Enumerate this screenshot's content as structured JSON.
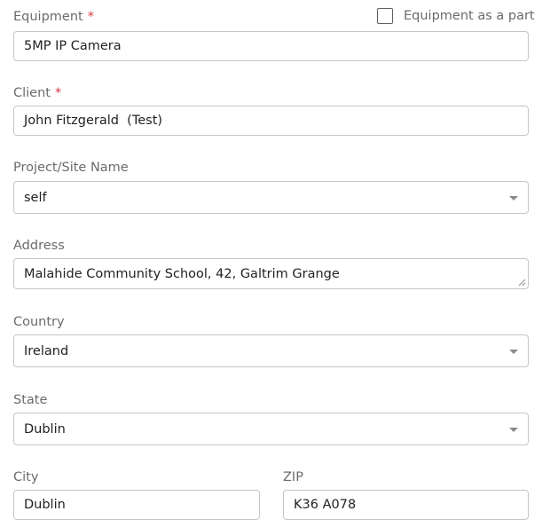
{
  "equipment": {
    "label": "Equipment",
    "required_mark": "*",
    "value": "5MP IP Camera",
    "as_part_label": "Equipment as a part",
    "as_part_checked": false
  },
  "client": {
    "label": "Client",
    "required_mark": "*",
    "value": "John Fitzgerald  (Test)"
  },
  "project": {
    "label": "Project/Site Name",
    "value": "self",
    "icon": "chevron-down-icon"
  },
  "address": {
    "label": "Address",
    "value": "Malahide Community School, 42, Galtrim Grange",
    "icon": "resize-handle-icon"
  },
  "country": {
    "label": "Country",
    "value": "Ireland",
    "icon": "chevron-down-icon"
  },
  "state": {
    "label": "State",
    "value": "Dublin",
    "icon": "chevron-down-icon"
  },
  "city": {
    "label": "City",
    "value": "Dublin"
  },
  "zip": {
    "label": "ZIP",
    "value": "K36 A078"
  },
  "colors": {
    "required": "#d9363e",
    "label": "#6b6b6b",
    "border": "#c6c6c6"
  }
}
